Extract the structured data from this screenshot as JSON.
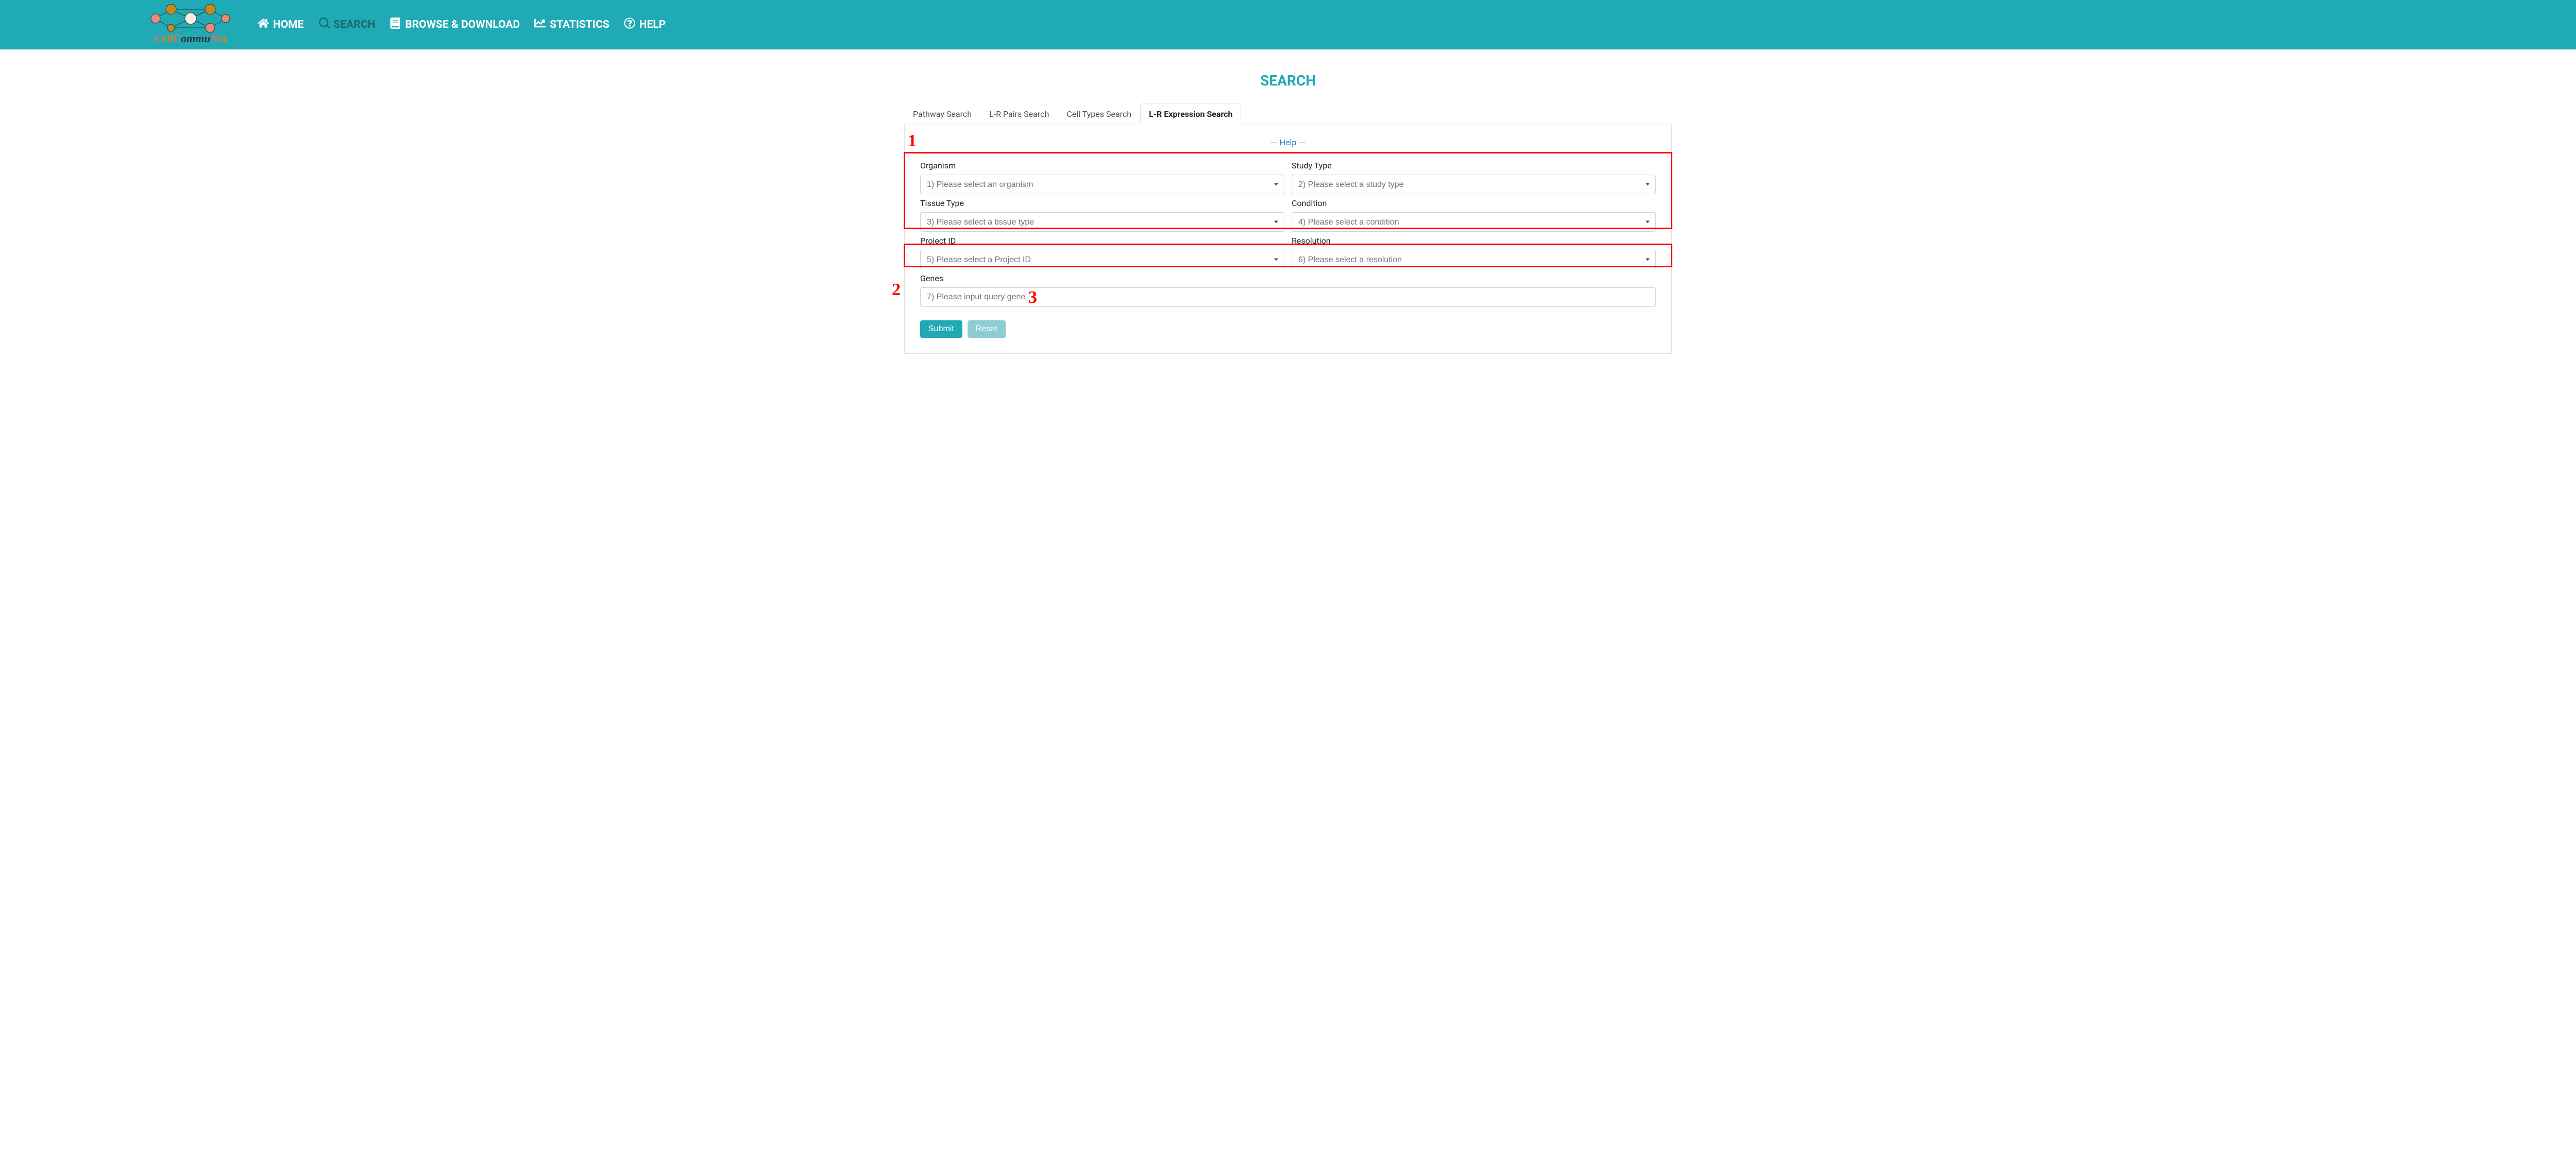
{
  "header": {
    "logo_text_parts": {
      "c": "C",
      "ell": "ell",
      "C2": "C",
      "ommu": "ommu",
      "N": "N",
      "et": "et"
    },
    "nav": {
      "home": "HOME",
      "search": "SEARCH",
      "browse": "BROWSE & DOWNLOAD",
      "stats": "STATISTICS",
      "help": "HELP"
    }
  },
  "page_title": "SEARCH",
  "tabs": {
    "pathway": "Pathway Search",
    "lr_pairs": "L-R Pairs Search",
    "cell_types": "Cell Types Search",
    "lr_expression": "L-R Expression Search"
  },
  "help_link": "--- Help ---",
  "form": {
    "organism": {
      "label": "Organism",
      "value": "1) Please select an organism"
    },
    "study_type": {
      "label": "Study Type",
      "value": "2) Please select a study type"
    },
    "tissue_type": {
      "label": "Tissue Type",
      "value": "3) Please select a tissue type"
    },
    "condition": {
      "label": "Condition",
      "value": "4) Please select a condition"
    },
    "project_id": {
      "label": "Project ID",
      "value": "5) Please select a Project ID"
    },
    "resolution": {
      "label": "Resolution",
      "value": "6) Please select a resolution"
    },
    "genes": {
      "label": "Genes",
      "placeholder": "7) Please input query gene"
    },
    "submit": "Submit",
    "reset": "Reset"
  },
  "annotations": {
    "a1": "1",
    "a2": "2",
    "a3": "3"
  }
}
